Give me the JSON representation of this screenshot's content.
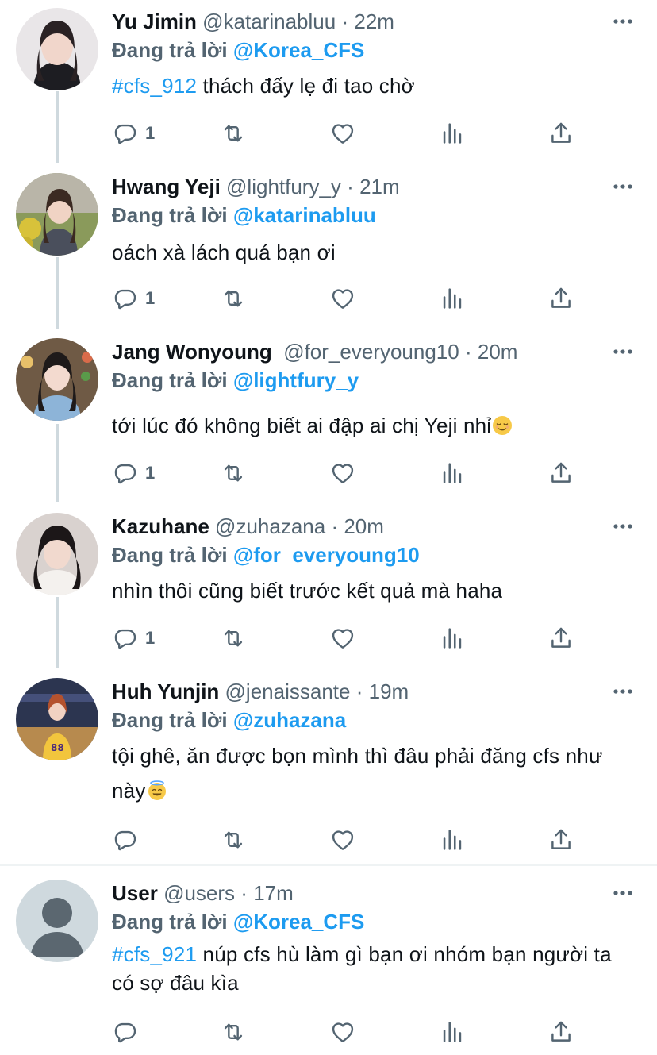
{
  "replying_to_label": "Đang trả lời",
  "icons": {
    "reply": "reply-icon",
    "retweet": "retweet-icon",
    "like": "heart-icon",
    "views": "analytics-icon",
    "share": "share-icon",
    "more": "more-icon"
  },
  "colors": {
    "mention": "#1d9bf0",
    "secondary": "#536471",
    "text": "#0f1419"
  },
  "tweets": [
    {
      "name": "Yu Jimin",
      "handle": "@katarinabluu",
      "time": "22m",
      "replying_to": "@Korea_CFS",
      "hashtag": "#cfs_912",
      "text": " thách đấy lẹ đi tao chờ",
      "reply_count": "1"
    },
    {
      "name": "Hwang Yeji",
      "handle": "@lightfury_y",
      "time": "21m",
      "replying_to": "@katarinabluu",
      "hashtag": "",
      "text": "oách xà lách quá bạn ơi",
      "reply_count": "1"
    },
    {
      "name": "Jang Wonyoung",
      "handle": "@for_everyoung10",
      "time": "20m",
      "replying_to": "@lightfury_y",
      "hashtag": "",
      "text": "tới lúc đó không biết ai đập ai chị Yeji nhỉ",
      "emoji": "relieved-face-emoji",
      "reply_count": "1"
    },
    {
      "name": "Kazuhane",
      "handle": "@zuhazana",
      "time": "20m",
      "replying_to": "@for_everyoung10",
      "hashtag": "",
      "text": "nhìn thôi cũng biết trước kết quả mà haha",
      "reply_count": "1"
    },
    {
      "name": "Huh Yunjin",
      "handle": "@jenaissante",
      "time": "19m",
      "replying_to": "@zuhazana",
      "hashtag": "",
      "text": "tội ghê, ăn được bọn mình thì đâu phải đăng cfs như này",
      "emoji": "smiling-face-with-halo-emoji",
      "reply_count": ""
    },
    {
      "name": "User",
      "handle": "@users",
      "time": "17m",
      "replying_to": "@Korea_CFS",
      "hashtag": "#cfs_921",
      "text": " núp cfs hù làm gì bạn ơi nhóm bạn người ta có sợ đâu kìa",
      "reply_count": ""
    }
  ]
}
